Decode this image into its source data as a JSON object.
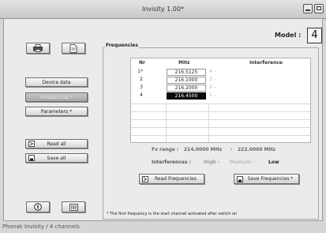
{
  "window": {
    "title": "Invisity 1.00*"
  },
  "model": {
    "label": "Model :",
    "value": "4"
  },
  "sidebar": {
    "buttons": [
      {
        "label": "Device data"
      },
      {
        "label": "Frequencies *"
      },
      {
        "label": "Parameters *"
      }
    ],
    "read_all": "Read all",
    "save_all": "Save all"
  },
  "frequencies": {
    "legend": "Frequencies",
    "headers": {
      "nr": "Nr",
      "mhz": "MHz",
      "interference": "Interference"
    },
    "rows": [
      {
        "nr": "1*",
        "mhz": "216.5125",
        "interference": "4 -"
      },
      {
        "nr": "2",
        "mhz": "216.1000",
        "interference": "3 -"
      },
      {
        "nr": "3",
        "mhz": "216.2000",
        "interference": "2 -"
      },
      {
        "nr": "4",
        "mhz": "216.4500",
        "interference": "1 -"
      }
    ],
    "fx_range_label": "Fx range :",
    "fx_range_min": "214.0000 MHz",
    "fx_range_sep": "-",
    "fx_range_max": "222.0000 MHz",
    "interferences_label": "Interferences :",
    "levels": {
      "high": "High -",
      "medium": "Medium -",
      "low": "Low"
    },
    "read_button": "Read Frequencies",
    "save_button": "Save Frequencies *",
    "footnote": "* The first frequency is the start channel activated after switch on"
  },
  "status": {
    "text": "Phonak Invisity  /  4 channels"
  }
}
